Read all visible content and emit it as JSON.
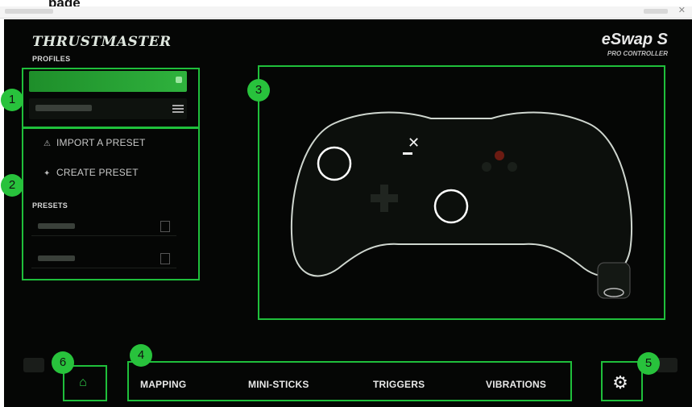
{
  "doc": {
    "heading": "page"
  },
  "app": {
    "brand": "THRUSTMASTER",
    "product": "eSwap S",
    "product_sub": "PRO CONTROLLER"
  },
  "profiles": {
    "label": "PROFILES"
  },
  "actions": {
    "import_label": "IMPORT A PRESET",
    "create_label": "CREATE PRESET"
  },
  "presets": {
    "label": "PRESETS"
  },
  "tabs": [
    {
      "label": "MAPPING"
    },
    {
      "label": "MINI-STICKS"
    },
    {
      "label": "TRIGGERS"
    },
    {
      "label": "VIBRATIONS"
    }
  ],
  "badges": [
    "1",
    "2",
    "3",
    "4",
    "5",
    "6"
  ],
  "icons": {
    "settings": "gear-icon",
    "home": "home-icon",
    "import": "warning-triangle-icon",
    "create": "plus-icon",
    "menu": "menu-icon"
  },
  "colors": {
    "accent_green": "#1fbf3b",
    "badge_green": "#28c23c",
    "background": "#050605"
  }
}
